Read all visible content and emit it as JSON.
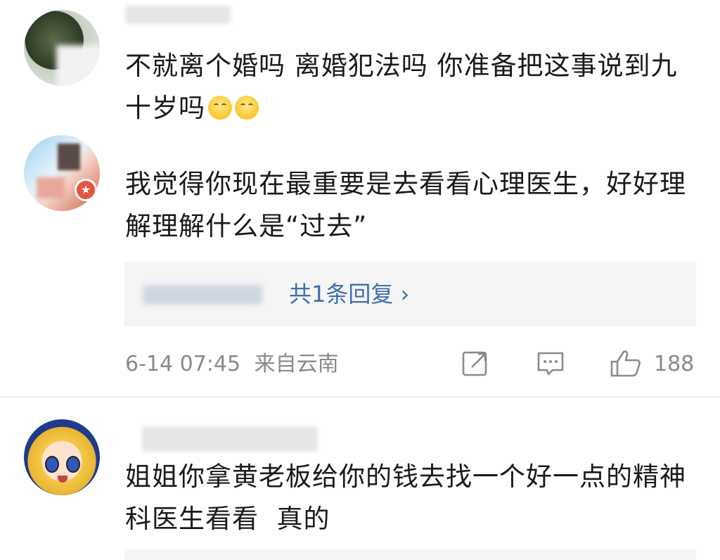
{
  "comments": [
    {
      "text": "不就离个婚吗 离婚犯法吗 你准备把这事说到九十岁吗",
      "emoji": [
        "smiling-face-icon",
        "smiling-face-icon"
      ]
    },
    {
      "text": "我觉得你现在最重要是去看看心理医生，好好理解理解什么是“过去”",
      "reply_link": "共1条回复 ›",
      "timestamp": "6-14 07:45",
      "location": "来自云南",
      "likes": "188"
    },
    {
      "text": "姐姐你拿黄老板给你的钱去找一个好一点的精神科医生看看  真的"
    }
  ],
  "colors": {
    "link": "#3e6fb0",
    "meta": "#8a8a8a",
    "badge": "#e8553f"
  }
}
